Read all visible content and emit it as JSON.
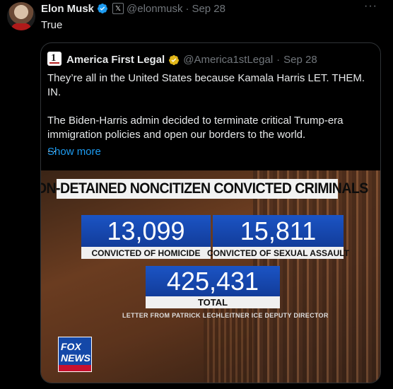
{
  "tweet": {
    "author_name": "Elon Musk",
    "handle": "@elonmusk",
    "separator": "·",
    "date": "Sep 28",
    "text": "True",
    "more_icon": "more-horizontal-icon"
  },
  "quote": {
    "author_name": "America First Legal",
    "handle": "@America1stLegal",
    "separator": "·",
    "date": "Sep 28",
    "paragraph1": "They’re all in the United States because Kamala Harris LET. THEM. IN.",
    "paragraph2": "The Biden-Harris admin decided to terminate critical Trump-era immigration policies and open our borders to the world.",
    "ellipsis": "...",
    "show_more": "Show more"
  },
  "media": {
    "headline": "NON-DETAINED NONCITIZEN CONVICTED CRIMINALS",
    "stat1_value": "13,099",
    "stat1_label": "CONVICTED OF HOMICIDE",
    "stat2_value": "15,811",
    "stat2_label": "CONVICTED OF SEXUAL ASSAULT",
    "stat3_value": "425,431",
    "stat3_label": "TOTAL",
    "source": "LETTER FROM PATRICK LECHLEITNER ICE DEPUTY DIRECTOR",
    "logo_line1": "FOX",
    "logo_line2": "NEWS"
  },
  "colors": {
    "background": "#000000",
    "text": "#e7e9ea",
    "muted": "#71767b",
    "link": "#1d9bf0",
    "verified_blue": "#1d9bf0",
    "verified_gold": "#e2b719",
    "stat_blue": "#1b54c4"
  }
}
